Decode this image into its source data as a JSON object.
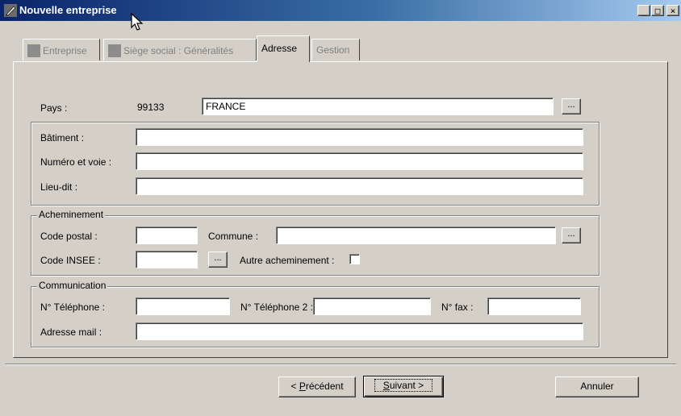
{
  "window": {
    "title": "Nouvelle entreprise",
    "minimize_glyph": "_",
    "maximize_glyph": "□",
    "close_glyph": "×"
  },
  "tabs": [
    {
      "label": "Entreprise",
      "enabled": false
    },
    {
      "label": "Siège social : Généralités",
      "enabled": false
    },
    {
      "label": "Adresse",
      "enabled": true,
      "active": true
    },
    {
      "label": "Gestion",
      "enabled": false
    }
  ],
  "pays": {
    "label": "Pays :",
    "code": "99133",
    "value": "FRANCE",
    "lookup": "..."
  },
  "adresse": {
    "batiment_label": "Bâtiment :",
    "batiment_value": "",
    "voie_label": "Numéro et voie :",
    "voie_value": "",
    "lieudit_label": "Lieu-dit :",
    "lieudit_value": ""
  },
  "acheminement": {
    "legend": "Acheminement",
    "cp_label": "Code postal :",
    "cp_value": "",
    "commune_label": "Commune :",
    "commune_value": "",
    "commune_lookup": "...",
    "insee_label": "Code INSEE :",
    "insee_value": "",
    "insee_lookup": "...",
    "autre_label": "Autre acheminement :",
    "autre_checked": false
  },
  "communication": {
    "legend": "Communication",
    "tel1_label": "N° Téléphone :",
    "tel1_value": "",
    "tel2_label": "N° Téléphone 2 :",
    "tel2_value": "",
    "fax_label": "N° fax :",
    "fax_value": "",
    "mail_label": "Adresse mail  :",
    "mail_value": ""
  },
  "buttons": {
    "previous_prefix": "< ",
    "previous_accel": "P",
    "previous_rest": "récédent",
    "next_accel": "S",
    "next_rest": "uivant >",
    "cancel": "Annuler"
  }
}
